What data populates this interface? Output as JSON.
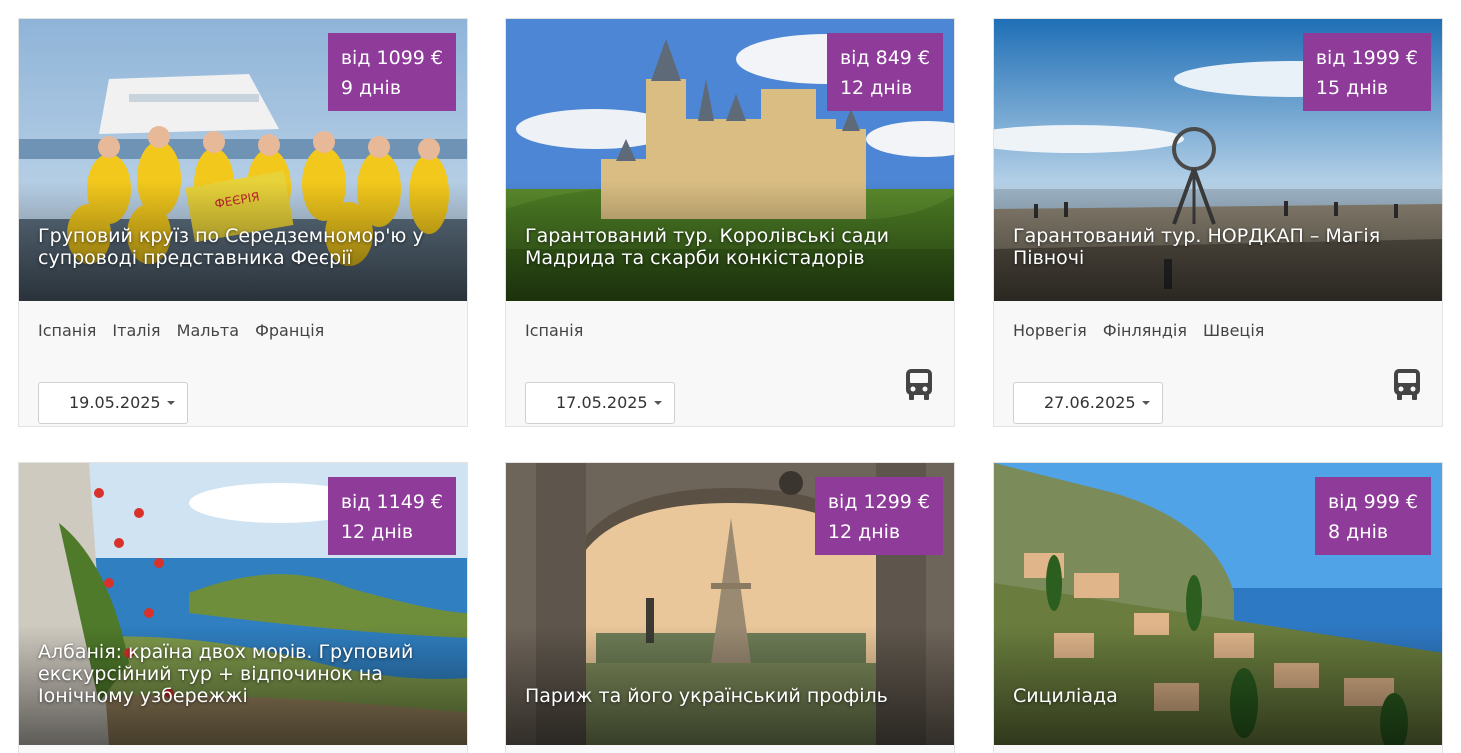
{
  "tours": [
    {
      "price": "від 1099 €",
      "days": "9 днів",
      "title": "Груповий круїз по Середземномор'ю у супроводі представника Феєрії",
      "countries": [
        "Іспанія",
        "Італія",
        "Мальта",
        "Франція"
      ],
      "date": "19.05.2025",
      "has_bus": false,
      "image": "cruise-group-photo"
    },
    {
      "price": "від 849 €",
      "days": "12 днів",
      "title": "Гарантований тур. Королівські сади Мадрида та скарби конкістадорів",
      "countries": [
        "Іспанія"
      ],
      "date": "17.05.2025",
      "has_bus": true,
      "image": "castle-photo"
    },
    {
      "price": "від 1999 €",
      "days": "15 днів",
      "title": "Гарантований тур. НОРДКАП – Магія Півночі",
      "countries": [
        "Норвегія",
        "Фінляндія",
        "Швеція"
      ],
      "date": "27.06.2025",
      "has_bus": true,
      "image": "nordkapp-globe-photo"
    },
    {
      "price": "від 1149 €",
      "days": "12 днів",
      "title": "Албанія: країна двох морів. Груповий екскурсійний тур + відпочинок на Іонічному узбережжі",
      "image": "albania-coast-photo"
    },
    {
      "price": "від 1299 €",
      "days": "12 днів",
      "title": "Париж та його український профіль",
      "image": "paris-arch-photo"
    },
    {
      "price": "від 999 €",
      "days": "8 днів",
      "title": "Сициліада",
      "image": "sicily-town-photo"
    }
  ],
  "colors": {
    "price_badge": "#8e3b9a",
    "card_bg": "#f8f8f8"
  },
  "icons": {
    "bus": "bus-icon",
    "dropdown": "chevron-down-icon"
  }
}
